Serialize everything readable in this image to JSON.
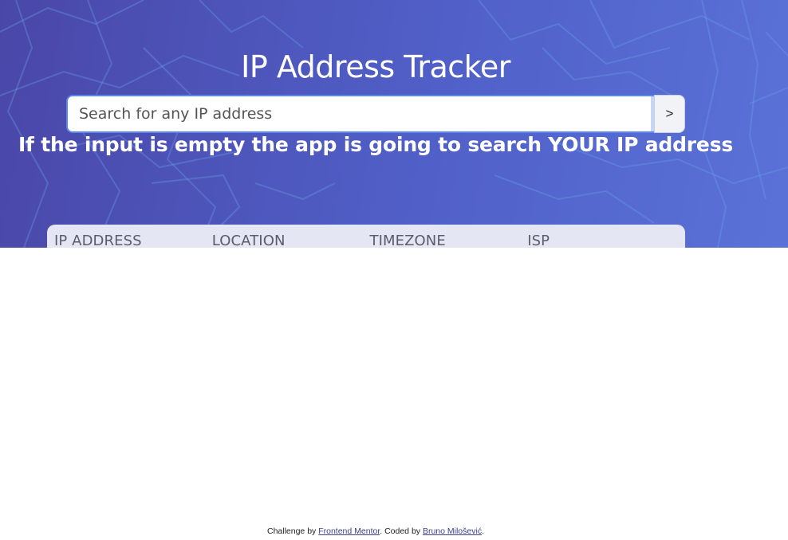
{
  "header": {
    "title": "IP Address Tracker",
    "hint": "If the input is empty the app is going to search YOUR IP address"
  },
  "search": {
    "placeholder": "Search for any IP address",
    "value": "",
    "submit_label": ">"
  },
  "info_card": {
    "columns": [
      {
        "label": "IP ADDRESS"
      },
      {
        "label": "LOCATION"
      },
      {
        "label": "TIMEZONE"
      },
      {
        "label": "ISP"
      }
    ]
  },
  "footer": {
    "challenge_prefix": "Challenge by ",
    "challenge_link": "Frontend Mentor",
    "coded_prefix": ". Coded by ",
    "author_link": "Bruno Milošević",
    "suffix": "."
  },
  "colors": {
    "hero_gradient_start": "#4a47a8",
    "hero_gradient_end": "#5a72d8",
    "input_focus_border": "#5a86f0",
    "card_background": "#e4e6f3",
    "link": "#3b3f8a"
  }
}
